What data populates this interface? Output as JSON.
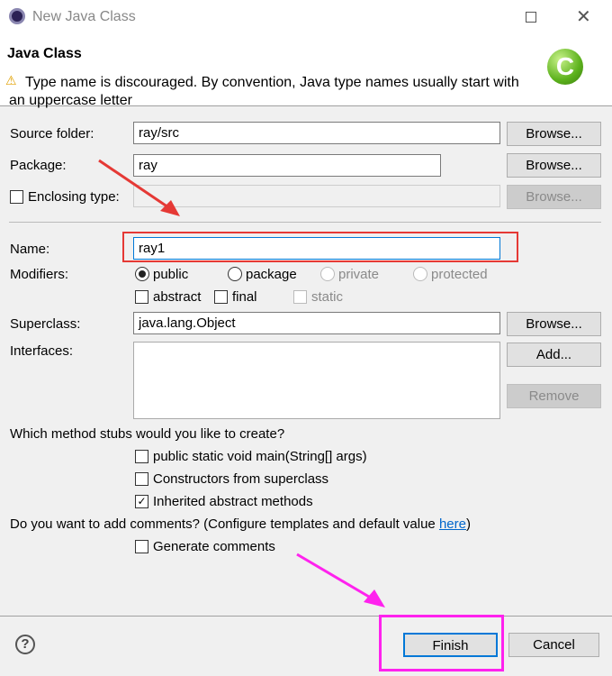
{
  "window": {
    "title": "New Java Class",
    "icon": "eclipse-icon"
  },
  "header": {
    "title": "Java Class",
    "warning": "Type name is discouraged. By convention, Java type names usually start with an uppercase letter",
    "warning_line1": "Type name is discouraged. By convention, Java type names usually start with",
    "warning_line2": "an uppercase letter",
    "logo": "java-class-c-icon"
  },
  "form": {
    "source_folder": {
      "label": "Source folder:",
      "value": "ray/src",
      "button": "Browse..."
    },
    "package": {
      "label": "Package:",
      "value": "ray",
      "button": "Browse..."
    },
    "enclosing": {
      "label": "Enclosing type:",
      "value": "",
      "button": "Browse...",
      "checked": false
    },
    "name": {
      "label": "Name:",
      "value": "ray1"
    },
    "modifiers": {
      "label": "Modifiers:",
      "radios": [
        "public",
        "package",
        "private",
        "protected"
      ],
      "selected": "public",
      "checks": [
        "abstract",
        "final",
        "static"
      ]
    },
    "superclass": {
      "label": "Superclass:",
      "value": "java.lang.Object",
      "button": "Browse..."
    },
    "interfaces": {
      "label": "Interfaces:",
      "add": "Add...",
      "remove": "Remove"
    },
    "stubs": {
      "question": "Which method stubs would you like to create?",
      "options": [
        {
          "label": "public static void main(String[] args)",
          "checked": false
        },
        {
          "label": "Constructors from superclass",
          "checked": false
        },
        {
          "label": "Inherited abstract methods",
          "checked": true
        }
      ]
    },
    "comments": {
      "question": "Do you want to add comments? (Configure templates and default value ",
      "link": "here",
      "close": ")",
      "option": "Generate comments",
      "checked": false
    }
  },
  "footer": {
    "help": "help-icon",
    "finish": "Finish",
    "cancel": "Cancel"
  },
  "annotations": {
    "red": "#e53935",
    "magenta": "#ff22ee"
  }
}
